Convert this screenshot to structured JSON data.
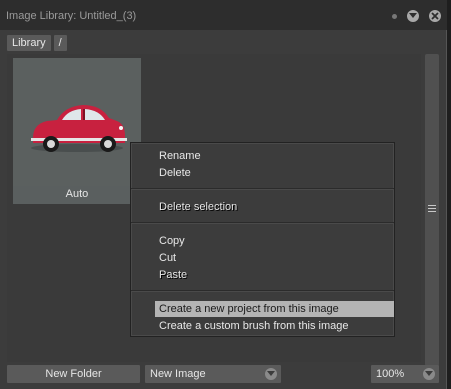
{
  "window": {
    "title": "Image Library: Untitled_(3)"
  },
  "icons": {
    "dot": "dot-icon",
    "minimize": "chevron-down-icon",
    "close": "close-icon",
    "grip": "grip-icon",
    "dropdown": "chevron-down-icon"
  },
  "breadcrumbs": [
    "Library",
    "/"
  ],
  "thumbnail": {
    "label": "Auto",
    "icon": "red-car-image"
  },
  "context_menu": {
    "rename": "Rename",
    "delete": "Delete",
    "delete_selection": "Delete selection",
    "copy": "Copy",
    "cut": "Cut",
    "paste": "Paste",
    "new_project": "Create a new project from this image",
    "custom_brush": "Create a custom brush from this image"
  },
  "footer": {
    "new_folder": "New Folder",
    "new_image": "New Image",
    "zoom": "100%"
  },
  "colors": {
    "highlight": "#b4b4b4",
    "car": "#c8213f"
  }
}
